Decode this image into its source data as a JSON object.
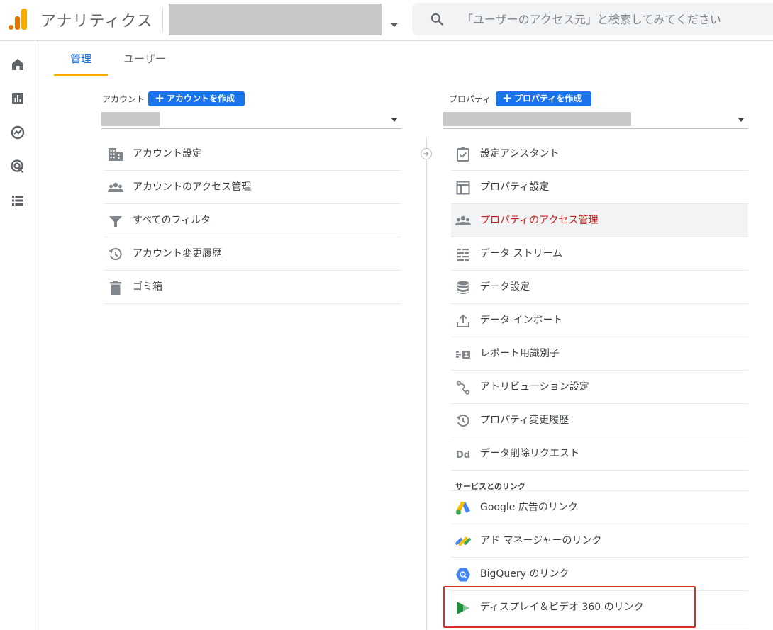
{
  "app": {
    "title": "アナリティクス",
    "accent_color": "#1a73e8",
    "logo_colors": [
      "#e37400",
      "#f9ab00"
    ]
  },
  "search": {
    "placeholder": "「ユーザーのアクセス元」と検索してみてください",
    "icon": "search-icon"
  },
  "rail": {
    "items": [
      {
        "icon": "home-icon"
      },
      {
        "icon": "reports-icon"
      },
      {
        "icon": "explore-icon"
      },
      {
        "icon": "advertising-icon"
      },
      {
        "icon": "configure-icon"
      }
    ]
  },
  "tabs": [
    {
      "label": "管理",
      "active": true
    },
    {
      "label": "ユーザー",
      "active": false
    }
  ],
  "account": {
    "label": "アカウント",
    "create_button": "アカウントを作成",
    "menu": [
      {
        "label": "アカウント設定",
        "icon": "building-icon"
      },
      {
        "label": "アカウントのアクセス管理",
        "icon": "people-icon"
      },
      {
        "label": "すべてのフィルタ",
        "icon": "filter-icon"
      },
      {
        "label": "アカウント変更履歴",
        "icon": "history-icon"
      },
      {
        "label": "ゴミ箱",
        "icon": "trash-icon"
      }
    ]
  },
  "property": {
    "label": "プロパティ",
    "create_button": "プロパティを作成",
    "menu": [
      {
        "label": "設定アシスタント",
        "icon": "checklist-icon"
      },
      {
        "label": "プロパティ設定",
        "icon": "property-icon"
      },
      {
        "label": "プロパティのアクセス管理",
        "icon": "people-icon",
        "active": true
      },
      {
        "label": "データ ストリーム",
        "icon": "streams-icon"
      },
      {
        "label": "データ設定",
        "icon": "database-icon"
      },
      {
        "label": "データ インポート",
        "icon": "upload-icon"
      },
      {
        "label": "レポート用識別子",
        "icon": "identity-icon"
      },
      {
        "label": "アトリビューション設定",
        "icon": "attribution-icon"
      },
      {
        "label": "プロパティ変更履歴",
        "icon": "history-icon"
      },
      {
        "label": "データ削除リクエスト",
        "icon": "dd-icon"
      }
    ],
    "links_section": {
      "title": "サービスとのリンク",
      "items": [
        {
          "label": "Google 広告のリンク",
          "icon": "google-ads-icon"
        },
        {
          "label": "アド マネージャーのリンク",
          "icon": "ad-manager-icon"
        },
        {
          "label": "BigQuery のリンク",
          "icon": "bigquery-icon"
        },
        {
          "label": "ディスプレイ＆ビデオ 360 のリンク",
          "icon": "dv360-icon",
          "highlighted": true
        }
      ]
    }
  }
}
